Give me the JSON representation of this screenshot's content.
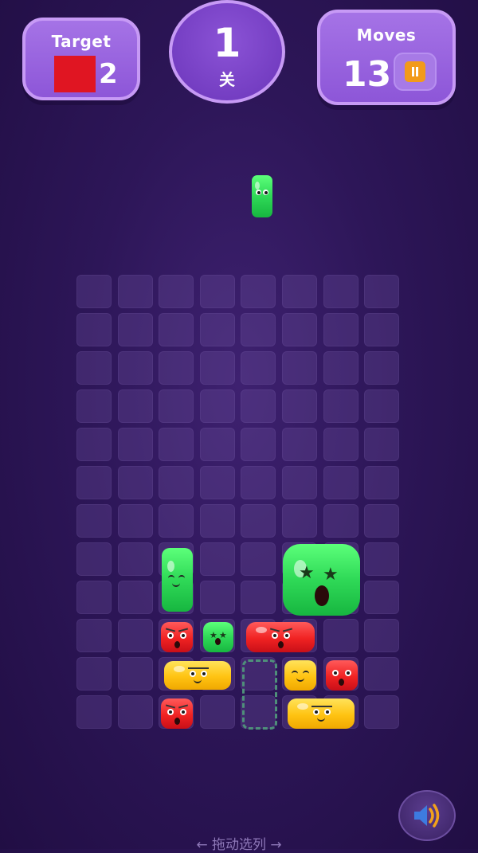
{
  "target": {
    "title": "Target",
    "color": "#e01522",
    "count": "2"
  },
  "level": {
    "number": "1",
    "label": "关"
  },
  "moves": {
    "title": "Moves",
    "count": "13"
  },
  "board": {
    "cols": 8,
    "rows": 12
  },
  "pieces": [
    {
      "name": "falling-green-jelly",
      "color": "green",
      "face": "dots"
    },
    {
      "name": "tall-green-jelly",
      "color": "green",
      "face": "smile-closed"
    },
    {
      "name": "big-green-jelly",
      "color": "green",
      "face": "star-shocked"
    },
    {
      "name": "red-jelly-small-1",
      "color": "red",
      "face": "angry"
    },
    {
      "name": "green-jelly-small",
      "color": "green",
      "face": "star-shocked"
    },
    {
      "name": "red-jelly-wide",
      "color": "red",
      "face": "angry"
    },
    {
      "name": "yellow-jelly-wide-1",
      "color": "yellow",
      "face": "dots"
    },
    {
      "name": "yellow-jelly-small",
      "color": "yellow",
      "face": "smile-closed"
    },
    {
      "name": "red-jelly-small-2",
      "color": "red",
      "face": "sad"
    },
    {
      "name": "red-jelly-small-3",
      "color": "red",
      "face": "angry"
    },
    {
      "name": "yellow-jelly-wide-2",
      "color": "yellow",
      "face": "dots"
    }
  ],
  "hint": "← 拖动选列 →"
}
